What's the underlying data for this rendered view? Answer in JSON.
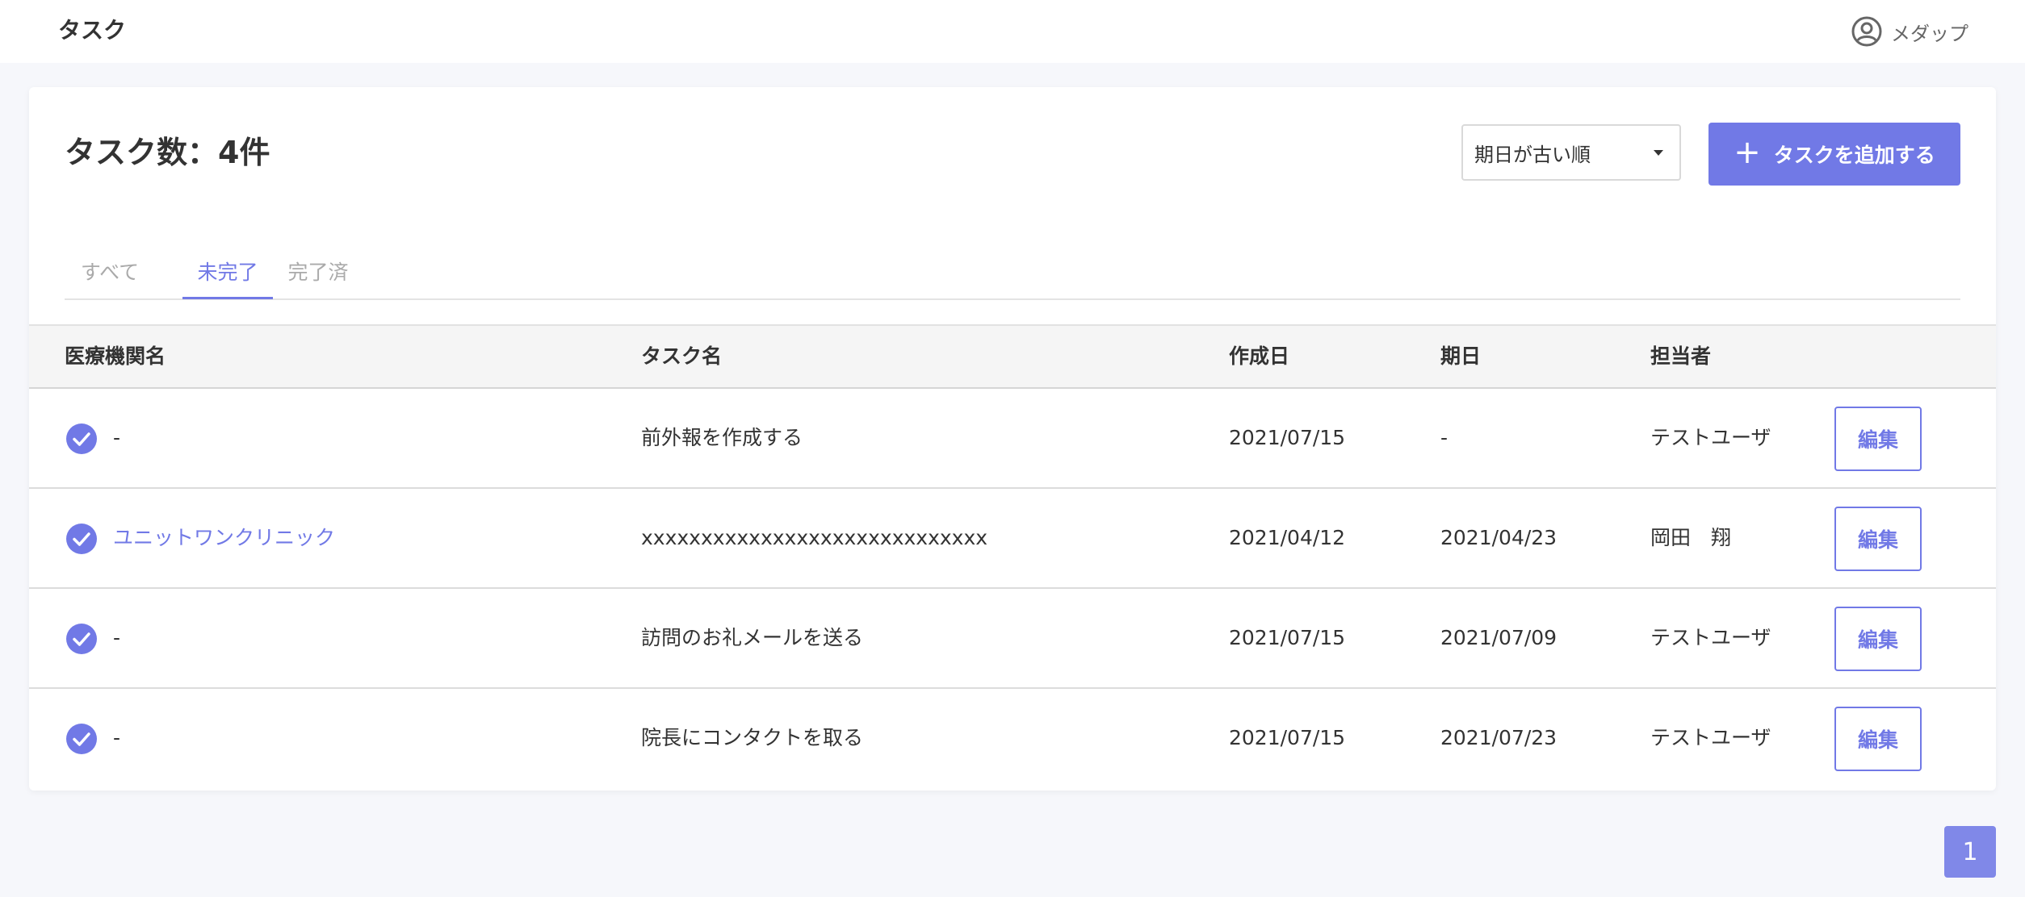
{
  "header": {
    "app_title": "タスク",
    "user_name": "メダップ",
    "user_icon": "user-circle-icon"
  },
  "main": {
    "count_title": "タスク数：4件",
    "sort": {
      "selected": "期日が古い順"
    },
    "add_button_label": "タスクを追加する",
    "tabs": [
      {
        "label": "すべて",
        "active": false
      },
      {
        "label": "未完了",
        "active": true
      },
      {
        "label": "完了済",
        "active": false
      }
    ],
    "table": {
      "columns": [
        "医療機関名",
        "タスク名",
        "作成日",
        "期日",
        "担当者"
      ],
      "rows": [
        {
          "clinic": "-",
          "clinic_is_link": false,
          "task": "前外報を作成する",
          "created": "2021/07/15",
          "due": "-",
          "assignee": "テストユーザ",
          "edit": "編集"
        },
        {
          "clinic": "ユニットワンクリニック",
          "clinic_is_link": true,
          "task": "xxxxxxxxxxxxxxxxxxxxxxxxxxxxx",
          "created": "2021/04/12",
          "due": "2021/04/23",
          "assignee": "岡田　翔",
          "edit": "編集"
        },
        {
          "clinic": "-",
          "clinic_is_link": false,
          "task": "訪問のお礼メールを送る",
          "created": "2021/07/15",
          "due": "2021/07/09",
          "assignee": "テストユーザ",
          "edit": "編集"
        },
        {
          "clinic": "-",
          "clinic_is_link": false,
          "task": "院長にコンタクトを取る",
          "created": "2021/07/15",
          "due": "2021/07/23",
          "assignee": "テストユーザ",
          "edit": "編集"
        }
      ]
    },
    "pagination": {
      "current": "1"
    }
  },
  "colors": {
    "accent": "#7179e6",
    "background": "#f6f7fb",
    "header_row": "#f5f5f5"
  }
}
